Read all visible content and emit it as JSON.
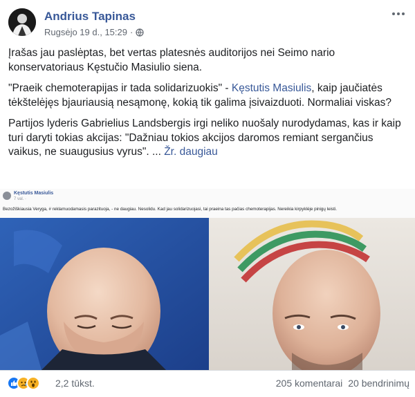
{
  "post": {
    "author": "Andrius Tapinas",
    "date": "Rugsėjo 19 d., 15:29",
    "separator": "·",
    "privacy_icon": "globe-icon",
    "more_icon": "ellipsis-icon",
    "paragraphs": {
      "p1": "Įrašas jau paslėptas, bet vertas platesnės auditorijos nei Seimo nario konservatoriaus Kęstučio Masiulio siena.",
      "p2_before": "\"Praeik chemoterapijas ir tada solidarizuokis\" - ",
      "p2_link": "Kęstutis Masiulis",
      "p2_after": ", kaip jaučiatės tėkštelėjęs bjauriausią nesąmonę, kokią tik galima įsivaizduoti. Normaliai viskas?",
      "p3": "Partijos lyderis Gabrielius Landsbergis irgi neliko nuošaly nurodydamas, kas ir kaip turi daryti tokias akcijas: \"Dažniau tokios akcijos daromos remiant sergančius vaikus, ne suaugusius vyrus\". ...",
      "see_more": "Žr. daugiau"
    }
  },
  "embed": {
    "name": "Kęstutis Masiulis",
    "time": "7 val. · ",
    "text": "Bezožiškiausia Veryga, # reklamuodamasis parazituoja, - ne daugiau. Nesolidu. Kad jau solidarizuojasi, tai praeina tas pačias chemoterapijas. Nereikia kirpyklėje pinigų leisti."
  },
  "footer": {
    "reactions": [
      "like-icon",
      "sad-icon",
      "wow-icon"
    ],
    "reaction_count": "2,2 tūkst.",
    "comments": "205 komentarai",
    "shares": "20 bendrinimų"
  },
  "colors": {
    "link": "#385898",
    "meta": "#616770",
    "like": "#1877f2",
    "sad": "#f7b125",
    "wow": "#f7b125"
  }
}
